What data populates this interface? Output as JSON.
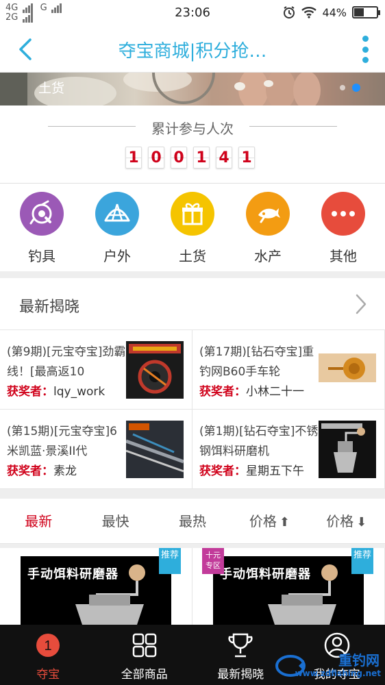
{
  "status_bar": {
    "net_top": "4G",
    "net_bottom": "2G",
    "net_mid": "G",
    "time": "23:06",
    "battery": "44%",
    "battery_level": 0.44
  },
  "header": {
    "title": "夺宝商城|积分抢…"
  },
  "banner": {
    "caption": "土货"
  },
  "counter": {
    "title": "累计参与人次",
    "digits": [
      "1",
      "0",
      "0",
      "1",
      "4",
      "1"
    ]
  },
  "categories": [
    {
      "label": "钓具",
      "icon": "fishing-reel-icon",
      "color": "#9b59b6"
    },
    {
      "label": "户外",
      "icon": "tent-icon",
      "color": "#3ba5dc"
    },
    {
      "label": "土货",
      "icon": "gift-icon",
      "color": "#f5c400"
    },
    {
      "label": "水产",
      "icon": "fish-icon",
      "color": "#f39c12"
    },
    {
      "label": "其他",
      "icon": "more-dots-icon",
      "color": "#e74c3c"
    }
  ],
  "latest": {
    "title": "最新揭晓",
    "winner_label": "获奖者：",
    "items": [
      {
        "name": "(第9期)[元宝夺宝]劲霸线！[最高返10",
        "winner": "lqy_work"
      },
      {
        "name": "(第17期)[钻石夺宝]重钓网B60手车轮",
        "winner": "小林二十一"
      },
      {
        "name": "(第15期)[元宝夺宝]6米凯蓝·景溪II代",
        "winner": "素龙"
      },
      {
        "name": "(第1期)[钻石夺宝]不锈钢饵料研磨机",
        "winner": "星期五下午"
      }
    ]
  },
  "sort_tabs": [
    "最新",
    "最快",
    "最热",
    "价格",
    "价格"
  ],
  "products": [
    {
      "img_title": "手动饵料研磨器",
      "badge": "推荐",
      "zone": ""
    },
    {
      "img_title": "手动饵料研磨器",
      "badge": "推荐",
      "zone": "十元专区"
    }
  ],
  "bottom_nav": [
    {
      "label": "夺宝",
      "icon": "badge-one-icon",
      "badge": "1"
    },
    {
      "label": "全部商品",
      "icon": "grid-icon"
    },
    {
      "label": "最新揭晓",
      "icon": "trophy-icon"
    },
    {
      "label": "我的夺宝",
      "icon": "user-icon"
    }
  ],
  "watermark": {
    "text": "重钓网",
    "url": "www.zdfishing.net"
  },
  "colors": {
    "accent": "#2eaedc",
    "winner": "#d0021b",
    "active_tab": "#d0021b"
  }
}
